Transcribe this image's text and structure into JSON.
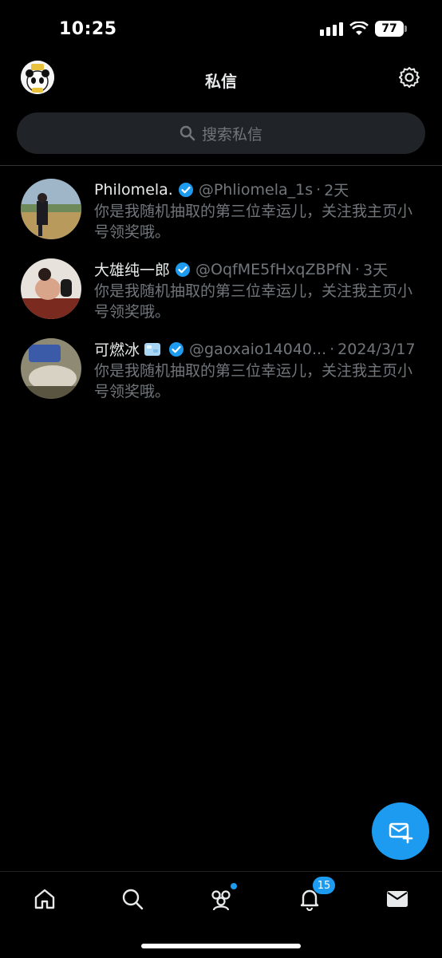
{
  "status_bar": {
    "time": "10:25",
    "battery": "77"
  },
  "header": {
    "title": "私信"
  },
  "search": {
    "placeholder": "搜索私信"
  },
  "conversations": [
    {
      "name": "Philomela.",
      "handle": "@Phliomela_1s",
      "time": "2天",
      "preview": "你是我随机抽取的第三位幸运儿，关注我主页小号领奖哦。"
    },
    {
      "name": "大雄纯一郎",
      "handle": "@OqfME5fHxqZBPfN",
      "time": "3天",
      "preview": "你是我随机抽取的第三位幸运儿，关注我主页小号领奖哦。"
    },
    {
      "name": "可燃冰",
      "handle": "@gaoxaio14040...",
      "time": "2024/3/17",
      "preview": "你是我随机抽取的第三位幸运儿，关注我主页小号领奖哦。"
    }
  ],
  "tabbar": {
    "notifications_count": "15"
  },
  "colors": {
    "accent": "#1d9bf0",
    "background": "#000000",
    "muted": "#71767b"
  },
  "icons": [
    "avatar",
    "gear-icon",
    "search-icon",
    "verified-badge-icon",
    "ice-emoji-icon",
    "new-message-icon",
    "home-icon",
    "explore-icon",
    "communities-icon",
    "notifications-icon",
    "messages-icon"
  ]
}
